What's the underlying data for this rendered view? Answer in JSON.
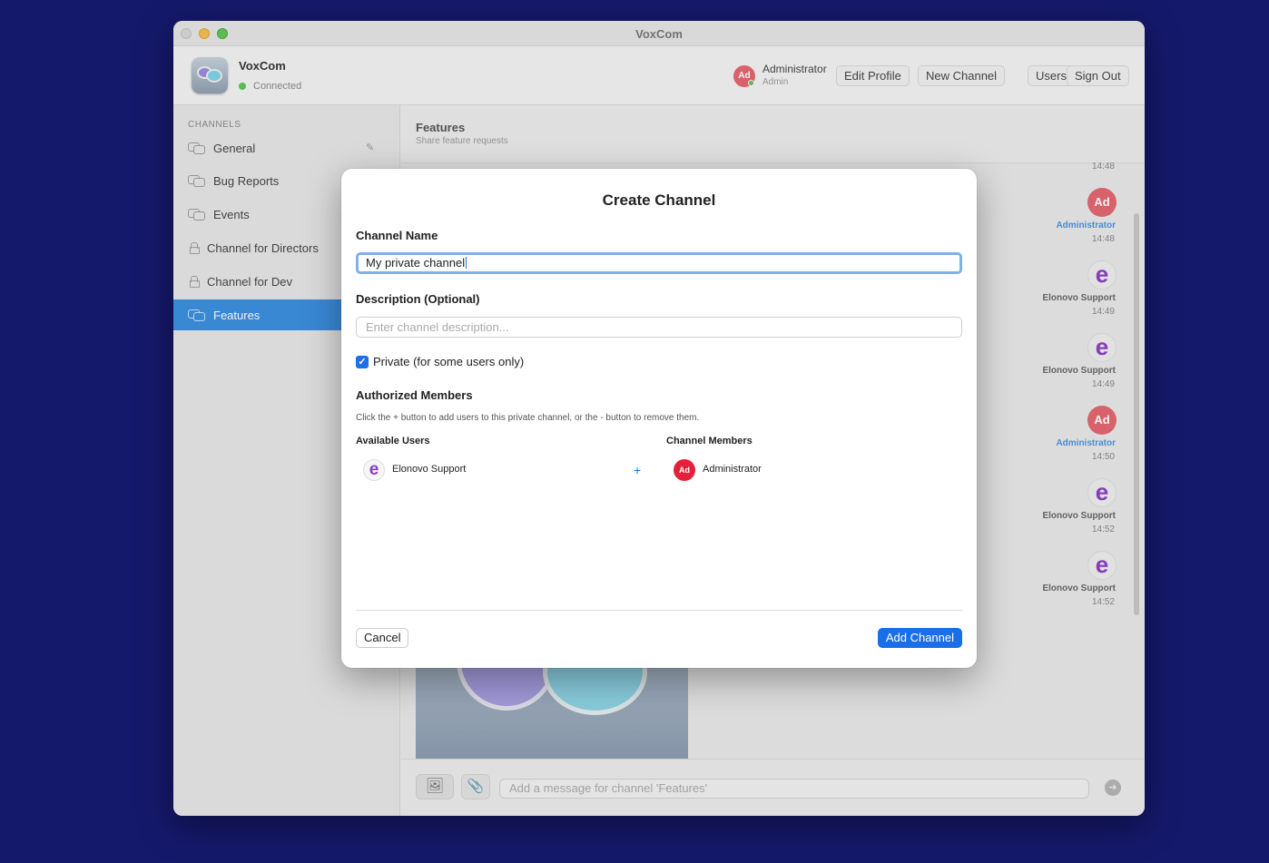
{
  "window": {
    "title": "VoxCom"
  },
  "app": {
    "name": "VoxCom",
    "status": "Connected",
    "status_color": "#5ec45a"
  },
  "user": {
    "avatar": "Ad",
    "name": "Administrator",
    "role": "Admin"
  },
  "header_buttons": {
    "edit_profile": "Edit Profile",
    "new_channel": "New Channel",
    "users": "Users",
    "sign_out": "Sign Out"
  },
  "sidebar": {
    "heading": "CHANNELS",
    "items": [
      {
        "label": "General",
        "icon": "chat-bubbles-icon"
      },
      {
        "label": "Bug Reports",
        "icon": "chat-bubbles-icon"
      },
      {
        "label": "Events",
        "icon": "chat-bubbles-icon"
      },
      {
        "label": "Channel for Directors",
        "icon": "lock-icon"
      },
      {
        "label": "Channel for Dev",
        "icon": "lock-icon"
      },
      {
        "label": "Features",
        "icon": "chat-bubbles-icon",
        "active": true
      }
    ],
    "accent": "#3a8fe0"
  },
  "chat": {
    "title": "Features",
    "subtitle": "Share feature requests",
    "messages": [
      {
        "time": "14:48"
      },
      {
        "avatar": "Ad",
        "name": "Administrator",
        "time": "14:48"
      },
      {
        "avatar": "e",
        "name": "Elonovo Support",
        "time": "14:49"
      },
      {
        "avatar": "e",
        "name": "Elonovo Support",
        "time": "14:49"
      },
      {
        "avatar": "Ad",
        "name": "Administrator",
        "time": "14:50"
      },
      {
        "avatar": "e",
        "name": "Elonovo Support",
        "time": "14:52"
      },
      {
        "avatar": "e",
        "name": "Elonovo Support",
        "time": "14:52"
      }
    ],
    "input_placeholder": "Add a message for channel 'Features'"
  },
  "dialog": {
    "title": "Create Channel",
    "name_label": "Channel Name",
    "name_value": "My private channel",
    "desc_label": "Description (Optional)",
    "desc_placeholder": "Enter channel description...",
    "private_label": "Private (for some users only)",
    "private_checked": true,
    "members_heading": "Authorized Members",
    "members_help": "Click the + button to add users to this private channel, or the - button to remove them.",
    "available_heading": "Available Users",
    "members_col_heading": "Channel Members",
    "available_users": [
      {
        "avatar": "e",
        "name": "Elonovo Support"
      }
    ],
    "channel_members": [
      {
        "avatar": "Ad",
        "name": "Administrator"
      }
    ],
    "add_symbol": "+",
    "cancel_label": "Cancel",
    "submit_label": "Add Channel",
    "primary_color": "#1a6fe8"
  }
}
